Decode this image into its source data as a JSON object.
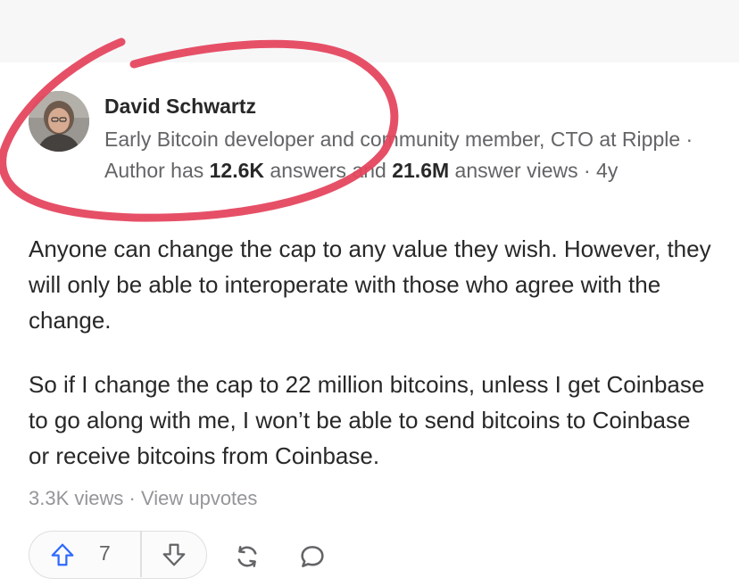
{
  "author": {
    "name": "David Schwartz",
    "credential_prefix": "Early Bitcoin developer and community member, CTO at Ripple · Author has ",
    "answers_count": "12.6K",
    "answers_text": " answers and ",
    "answer_views": "21.6M",
    "views_text": " answer views · ",
    "age": "4y"
  },
  "answer": {
    "paragraphs": [
      "Anyone can change the cap to any value they wish. However, they will only be able to interoperate with those who agree with the change.",
      "So if I change the cap to 22 million bitcoins, unless I get Coinbase to go along with me, I won’t be able to send bitcoins to Coinbase or receive bitcoins from Coinbase."
    ]
  },
  "stats": {
    "views": "3.3K views",
    "separator": " · ",
    "view_upvotes": "View upvotes"
  },
  "actions": {
    "upvote_count": "7",
    "upvote_icon": "arrow-up-icon",
    "downvote_icon": "arrow-down-icon",
    "share_icon": "share-icon",
    "comment_icon": "comment-icon"
  },
  "colors": {
    "accent": "#2e69ff",
    "annotation": "#e5475f",
    "text_primary": "#282829",
    "text_secondary": "#636466",
    "text_muted": "#939598"
  }
}
